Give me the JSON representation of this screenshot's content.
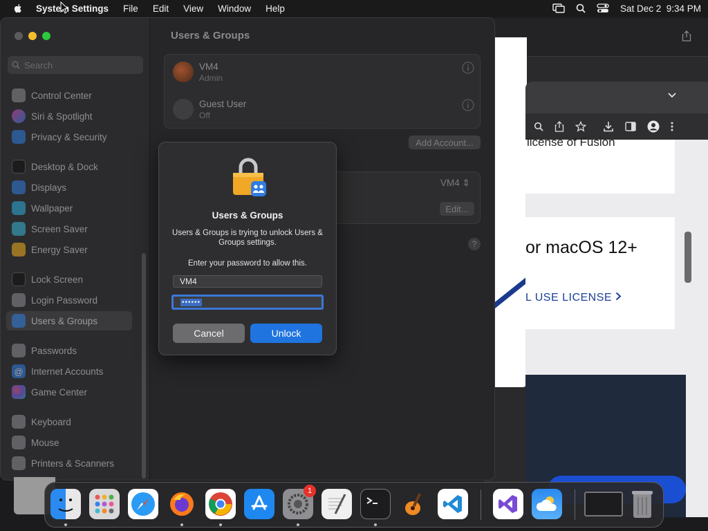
{
  "menubar": {
    "app_name": "System Settings",
    "menus": [
      "File",
      "Edit",
      "View",
      "Window",
      "Help"
    ],
    "datetime": "Sat Dec 2  9:34 PM"
  },
  "sidebar": {
    "search_placeholder": "Search",
    "items": [
      {
        "label": "Control Center",
        "icon": "control-center-icon",
        "color": "#8e8e93"
      },
      {
        "label": "Siri & Spotlight",
        "icon": "siri-icon",
        "color": "#b15cd6"
      },
      {
        "label": "Privacy & Security",
        "icon": "hand-icon",
        "color": "#2f7de1"
      },
      {
        "label": "Desktop & Dock",
        "icon": "dock-icon",
        "color": "#1c1c1e"
      },
      {
        "label": "Displays",
        "icon": "sun-icon",
        "color": "#2f7de1"
      },
      {
        "label": "Wallpaper",
        "icon": "wallpaper-icon",
        "color": "#30b0e0"
      },
      {
        "label": "Screen Saver",
        "icon": "screensaver-icon",
        "color": "#3ab8d8"
      },
      {
        "label": "Energy Saver",
        "icon": "lightbulb-icon",
        "color": "#f2b01e"
      },
      {
        "label": "Lock Screen",
        "icon": "lock-icon",
        "color": "#1c1c1e"
      },
      {
        "label": "Login Password",
        "icon": "key-icon",
        "color": "#8e8e93"
      },
      {
        "label": "Users & Groups",
        "icon": "users-icon",
        "color": "#2f7de1"
      },
      {
        "label": "Passwords",
        "icon": "passwords-icon",
        "color": "#8e8e93"
      },
      {
        "label": "Internet Accounts",
        "icon": "at-icon",
        "color": "#2f7de1"
      },
      {
        "label": "Game Center",
        "icon": "game-center-icon",
        "color": "#e8e8e8"
      },
      {
        "label": "Keyboard",
        "icon": "keyboard-icon",
        "color": "#8e8e93"
      },
      {
        "label": "Mouse",
        "icon": "mouse-icon",
        "color": "#8e8e93"
      },
      {
        "label": "Printers & Scanners",
        "icon": "printer-icon",
        "color": "#8e8e93"
      }
    ],
    "selected": "Users & Groups"
  },
  "main": {
    "title": "Users & Groups",
    "accounts": [
      {
        "name": "VM4",
        "role": "Admin"
      },
      {
        "name": "Guest User",
        "role": "Off"
      }
    ],
    "add_account_label": "Add Account...",
    "auto_login_value": "VM4",
    "edit_label": "Edit...",
    "help_label": "?"
  },
  "dialog": {
    "title": "Users & Groups",
    "message": "Users & Groups is trying to unlock Users & Groups settings.",
    "prompt": "Enter your password to allow this.",
    "username": "VM4",
    "password_mask": "••••••",
    "cancel_label": "Cancel",
    "unlock_label": "Unlock"
  },
  "browser": {
    "card1_text": "license of Fusion",
    "card2_heading": "or macOS 12+",
    "card2_link": "L USE LICENSE"
  },
  "dock": {
    "apps": [
      {
        "name": "finder-icon",
        "color": "#2a8af0",
        "running": true
      },
      {
        "name": "launchpad-icon",
        "color": "#d9d9d9",
        "running": false
      },
      {
        "name": "safari-icon",
        "color": "#2b9af3",
        "running": false
      },
      {
        "name": "firefox-icon",
        "color": "#ff7a1a",
        "running": true
      },
      {
        "name": "chrome-icon",
        "color": "#ffffff",
        "running": true
      },
      {
        "name": "app-store-icon",
        "color": "#1e88f0",
        "running": false
      },
      {
        "name": "system-settings-icon",
        "color": "#8e8e93",
        "running": true,
        "badge": "1"
      },
      {
        "name": "textedit-icon",
        "color": "#f0f0f0",
        "running": false
      },
      {
        "name": "terminal-icon",
        "color": "#1c1c1e",
        "running": true
      },
      {
        "name": "garageband-icon",
        "color": "#f08a24",
        "running": false
      },
      {
        "name": "vscode-icon",
        "color": "#ffffff",
        "running": false
      },
      {
        "name": "visual-studio-icon",
        "color": "#ffffff",
        "running": false
      },
      {
        "name": "weather-icon",
        "color": "#2a8af0",
        "running": false
      },
      {
        "name": "window-thumbnail-icon",
        "color": "#1c1c1e",
        "running": false
      },
      {
        "name": "trash-icon",
        "color": "#8e8e93",
        "running": false
      }
    ]
  }
}
